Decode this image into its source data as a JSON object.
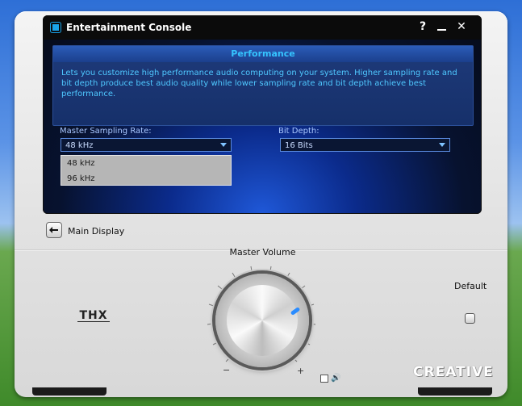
{
  "window": {
    "title": "Entertainment Console",
    "help_label": "?",
    "close_label": "✕"
  },
  "info": {
    "heading": "Performance",
    "text": "Lets you customize high performance audio computing on your system. Higher sampling rate and bit depth produce best audio quality while lower sampling rate and bit depth achieve best performance."
  },
  "sampling": {
    "label": "Master Sampling Rate:",
    "value": "48 kHz",
    "options": [
      "48 kHz",
      "96 kHz"
    ]
  },
  "bitdepth": {
    "label": "Bit Depth:",
    "value": "16 Bits"
  },
  "nav": {
    "main_display": "Main Display"
  },
  "volume": {
    "label": "Master Volume",
    "minus": "−",
    "plus": "+"
  },
  "default": {
    "label": "Default"
  },
  "brand": {
    "thx": "THX",
    "creative": "CREATIVE"
  }
}
